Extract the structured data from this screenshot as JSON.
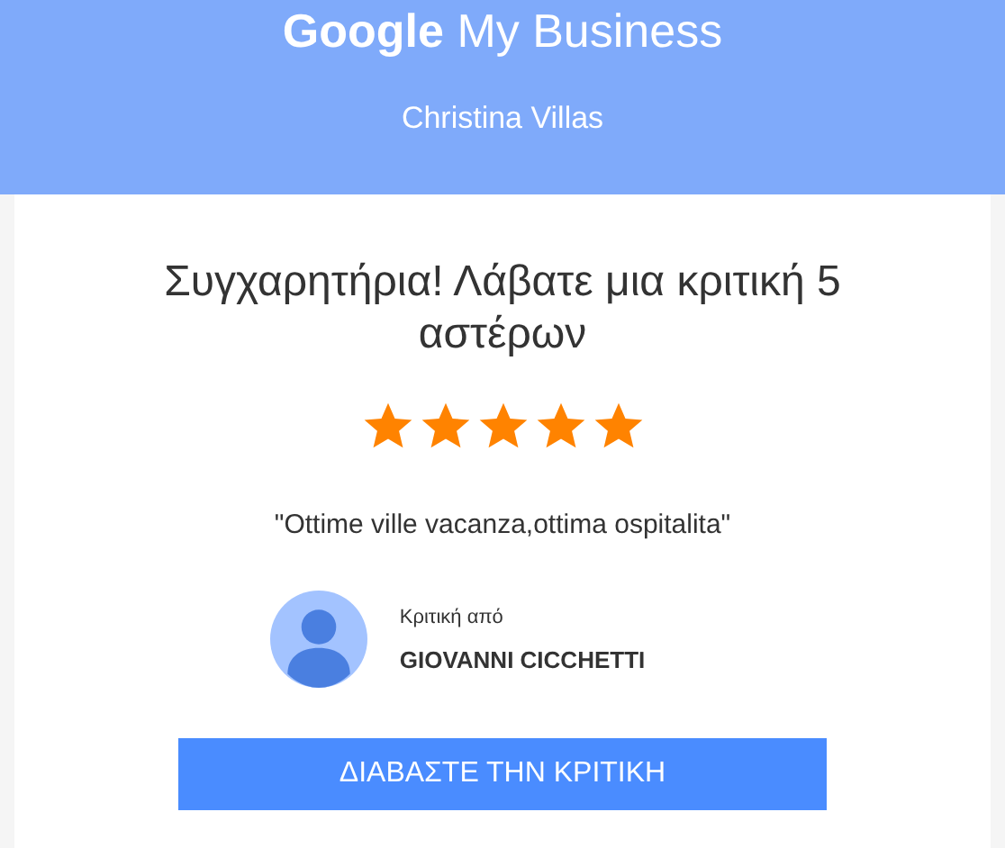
{
  "header": {
    "logo": {
      "brand": "Google",
      "product": "My Business"
    },
    "business_name": "Christina Villas"
  },
  "review": {
    "heading": "Συγχαρητήρια! Λάβατε μια κριτική 5 αστέρων",
    "stars": 5,
    "quote": "\"Ottime ville vacanza,ottima ospitalita\"",
    "reviewer_label": "Κριτική από",
    "reviewer_name": "GIOVANNI CICCHETTI"
  },
  "button": "ΔΙΑΒΑΣΤΕ ΤΗΝ ΚΡΙΤΙΚΗ"
}
